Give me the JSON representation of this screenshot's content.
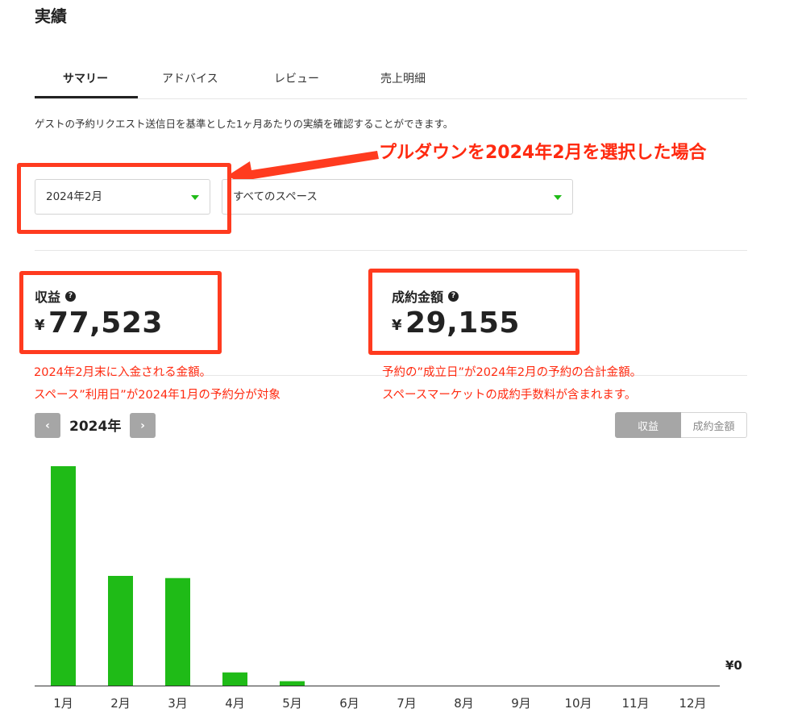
{
  "page": {
    "title": "実績"
  },
  "tabs": [
    {
      "label": "サマリー",
      "active": true
    },
    {
      "label": "アドバイス",
      "active": false
    },
    {
      "label": "レビュー",
      "active": false
    },
    {
      "label": "売上明細",
      "active": false
    }
  ],
  "description": "ゲストの予約リクエスト送信日を基準とした1ヶ月あたりの実績を確認することができます。",
  "filters": {
    "month": {
      "value": "2024年2月"
    },
    "space": {
      "value": "すべてのスペース"
    }
  },
  "kpis": {
    "revenue": {
      "label": "収益",
      "currency": "¥",
      "value": "77,523"
    },
    "contract": {
      "label": "成約金額",
      "currency": "¥",
      "value": "29,155"
    }
  },
  "help_icon": "?",
  "annotations": {
    "title": "プルダウンを2024年2月を選択した場合",
    "revenue_note_1": "2024年2月末に入金される金額。",
    "revenue_note_2": "スペース”利用日”が2024年1月の予約分が対象",
    "contract_note_1": "予約の”成立日”が2024年2月の予約の合計金額。",
    "contract_note_2": "スペースマーケットの成約手数料が含まれます。",
    "color": "#ff2a10"
  },
  "year_nav": {
    "prev": "‹",
    "next": "›",
    "year": "2024年"
  },
  "toggle": {
    "revenue": "収益",
    "contract": "成約金額",
    "selected": "revenue"
  },
  "colors": {
    "accent": "#1fbb17",
    "bar": "#1fbb17",
    "toggle_active": "#a6a6a6"
  },
  "chart_data": {
    "type": "bar",
    "categories": [
      "1月",
      "2月",
      "3月",
      "4月",
      "5月",
      "6月",
      "7月",
      "8月",
      "9月",
      "10月",
      "11月",
      "12月"
    ],
    "values": [
      100,
      50,
      49,
      6,
      2,
      0,
      0,
      0,
      0,
      0,
      0,
      0
    ],
    "baseline_label": "¥0"
  }
}
